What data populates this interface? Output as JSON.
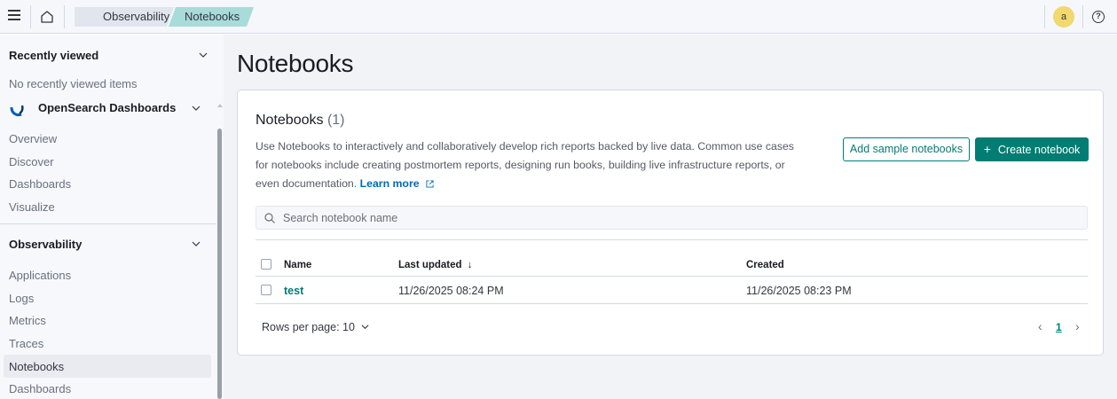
{
  "header": {
    "breadcrumbs": [
      "Observability",
      "Notebooks"
    ],
    "avatar_initial": "a"
  },
  "sidebar": {
    "recently_viewed": {
      "title": "Recently viewed",
      "empty_text": "No recently viewed items"
    },
    "osd_section": {
      "title": "OpenSearch Dashboards",
      "items": [
        "Overview",
        "Discover",
        "Dashboards",
        "Visualize"
      ]
    },
    "observability_section": {
      "title": "Observability",
      "items": [
        "Applications",
        "Logs",
        "Metrics",
        "Traces",
        "Notebooks",
        "Dashboards"
      ],
      "active": "Notebooks"
    }
  },
  "main": {
    "page_title": "Notebooks",
    "panel": {
      "title": "Notebooks",
      "count": "(1)",
      "description": "Use Notebooks to interactively and collaboratively develop rich reports backed by live data. Common use cases for notebooks include creating postmortem reports, designing run books, building live infrastructure reports, or even documentation.",
      "learn_more": "Learn more",
      "add_sample_label": "Add sample notebooks",
      "create_label": "Create notebook",
      "search_placeholder": "Search notebook name",
      "table": {
        "columns": [
          "Name",
          "Last updated",
          "Created"
        ],
        "sort_indicator": "↓",
        "rows": [
          {
            "name": "test",
            "last_updated": "11/26/2025 08:24 PM",
            "created": "11/26/2025 08:23 PM"
          }
        ]
      },
      "rows_per_page": "Rows per page: 10",
      "current_page": "1"
    }
  }
}
